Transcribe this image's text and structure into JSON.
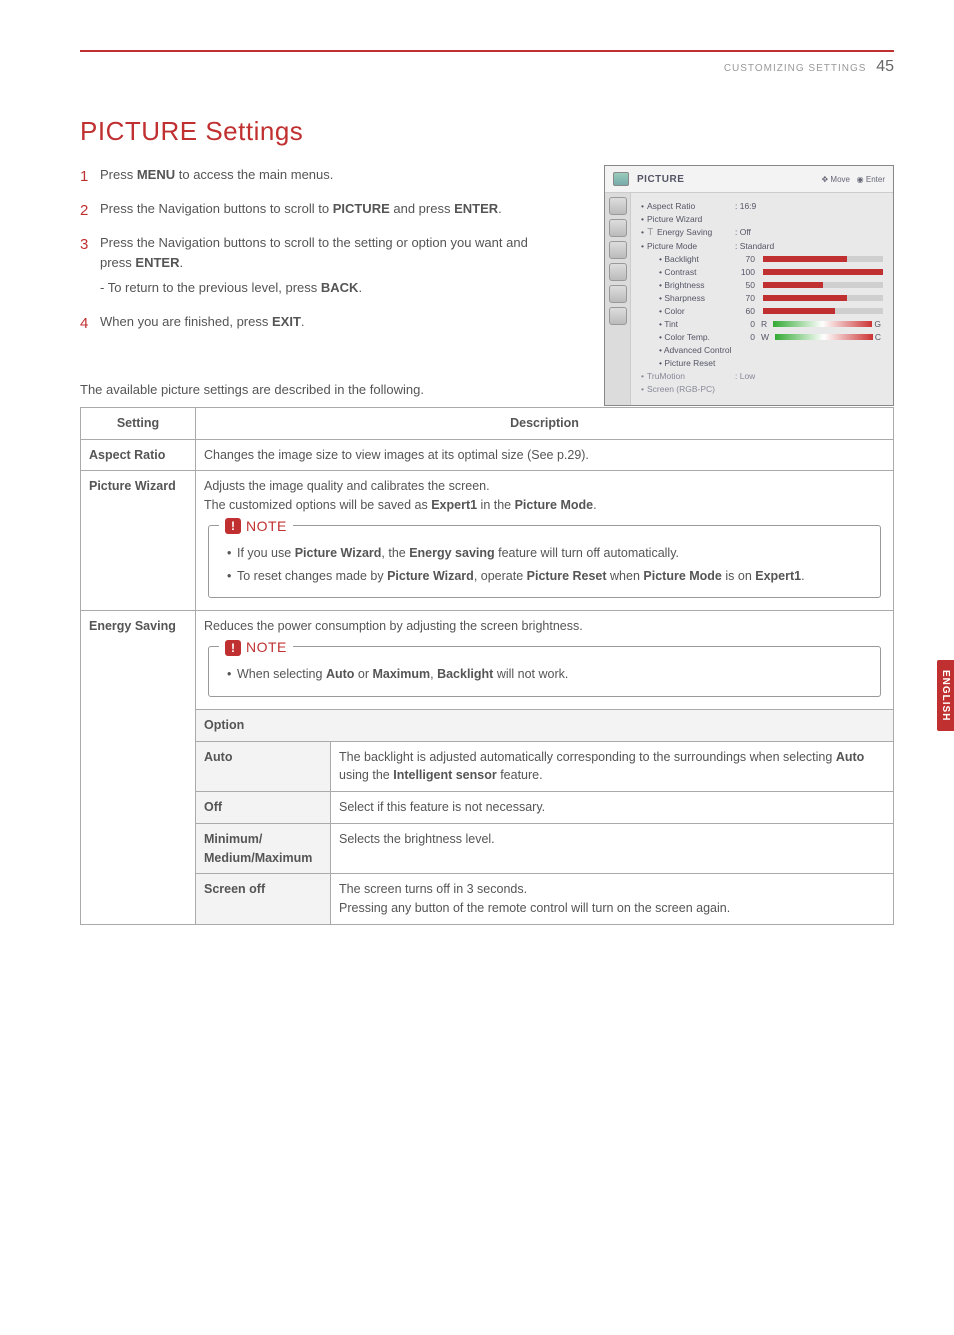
{
  "header": {
    "section": "CUSTOMIZING SETTINGS",
    "page": "45"
  },
  "side_tab": "ENGLISH",
  "title": "PICTURE Settings",
  "steps": {
    "s1_a": "Press ",
    "s1_b": "MENU",
    "s1_c": " to access the main menus.",
    "s2_a": "Press the Navigation buttons to scroll to ",
    "s2_b": "PICTURE",
    "s2_c": " and press ",
    "s2_d": "ENTER",
    "s2_e": ".",
    "s3_a": "Press the Navigation buttons to scroll to the setting or option you want and press ",
    "s3_b": "ENTER",
    "s3_c": ".",
    "s3_sub_a": "- To return to the previous level, press ",
    "s3_sub_b": "BACK",
    "s3_sub_c": ".",
    "s4_a": "When you are finished, press ",
    "s4_b": "EXIT",
    "s4_c": "."
  },
  "osd": {
    "title": "PICTURE",
    "move": "Move",
    "enter": "Enter",
    "rows": {
      "aspect": {
        "label": "Aspect Ratio",
        "value": ": 16:9"
      },
      "wizard": {
        "label": "Picture Wizard"
      },
      "energy": {
        "label": "Energy Saving",
        "value": ": Off",
        "eco": "ꔋ"
      },
      "mode": {
        "label": "Picture Mode",
        "value": ": Standard"
      },
      "backlight": {
        "label": "Backlight",
        "value": "70"
      },
      "contrast": {
        "label": "Contrast",
        "value": "100"
      },
      "brightness": {
        "label": "Brightness",
        "value": "50"
      },
      "sharpness": {
        "label": "Sharpness",
        "value": "70"
      },
      "color": {
        "label": "Color",
        "value": "60"
      },
      "tint": {
        "label": "Tint",
        "value": "0",
        "left": "R",
        "right": "G"
      },
      "colortemp": {
        "label": "Color Temp.",
        "value": "0",
        "left": "W",
        "right": "C"
      },
      "advanced": {
        "label": "Advanced Control"
      },
      "reset": {
        "label": "Picture Reset"
      },
      "trumotion": {
        "label": "TruMotion",
        "value": ": Low"
      },
      "screen": {
        "label": "Screen (RGB-PC)"
      }
    }
  },
  "table_caption": "The available picture settings are described in the following.",
  "thead": {
    "setting": "Setting",
    "description": "Description"
  },
  "rows": {
    "aspect": {
      "name": "Aspect Ratio",
      "desc": "Changes the image size to view images at its optimal size (See p.29)."
    },
    "wizard": {
      "name": "Picture Wizard",
      "line1": "Adjusts the image quality and calibrates the screen.",
      "line2a": "The customized options will be saved as ",
      "line2b": "Expert1",
      "line2c": " in the ",
      "line2d": "Picture Mode",
      "line2e": ".",
      "note_label": "NOTE",
      "note1a": "If you use ",
      "note1b": "Picture Wizard",
      "note1c": ", the ",
      "note1d": "Energy saving",
      "note1e": " feature will turn off automatically.",
      "note2a": "To reset changes made by ",
      "note2b": "Picture Wizard",
      "note2c": ", operate ",
      "note2d": "Picture Reset",
      "note2e": " when ",
      "note2f": "Picture Mode",
      "note2g": " is on ",
      "note2h": "Expert1",
      "note2i": "."
    },
    "energy": {
      "name": "Energy Saving",
      "desc": "Reduces the power consumption by adjusting the screen brightness.",
      "note_label": "NOTE",
      "note1a": "When selecting ",
      "note1b": "Auto",
      "note1c": " or ",
      "note1d": "Maximum",
      "note1e": ", ",
      "note1f": "Backlight",
      "note1g": " will not work.",
      "option_header": "Option",
      "opts": {
        "auto": {
          "name": "Auto",
          "desc_a": "The backlight is adjusted automatically corresponding to the surroundings when selecting ",
          "desc_b": "Auto",
          "desc_c": " using the ",
          "desc_d": "Intelligent sensor",
          "desc_e": " feature."
        },
        "off": {
          "name": "Off",
          "desc": "Select if this feature is not necessary."
        },
        "min": {
          "name": "Minimum/ Medium/Maximum",
          "desc": "Selects the brightness level."
        },
        "screenoff": {
          "name": "Screen off",
          "desc1": "The screen turns off in 3 seconds.",
          "desc2": "Pressing any button of the remote control will turn on the screen again."
        }
      }
    }
  }
}
